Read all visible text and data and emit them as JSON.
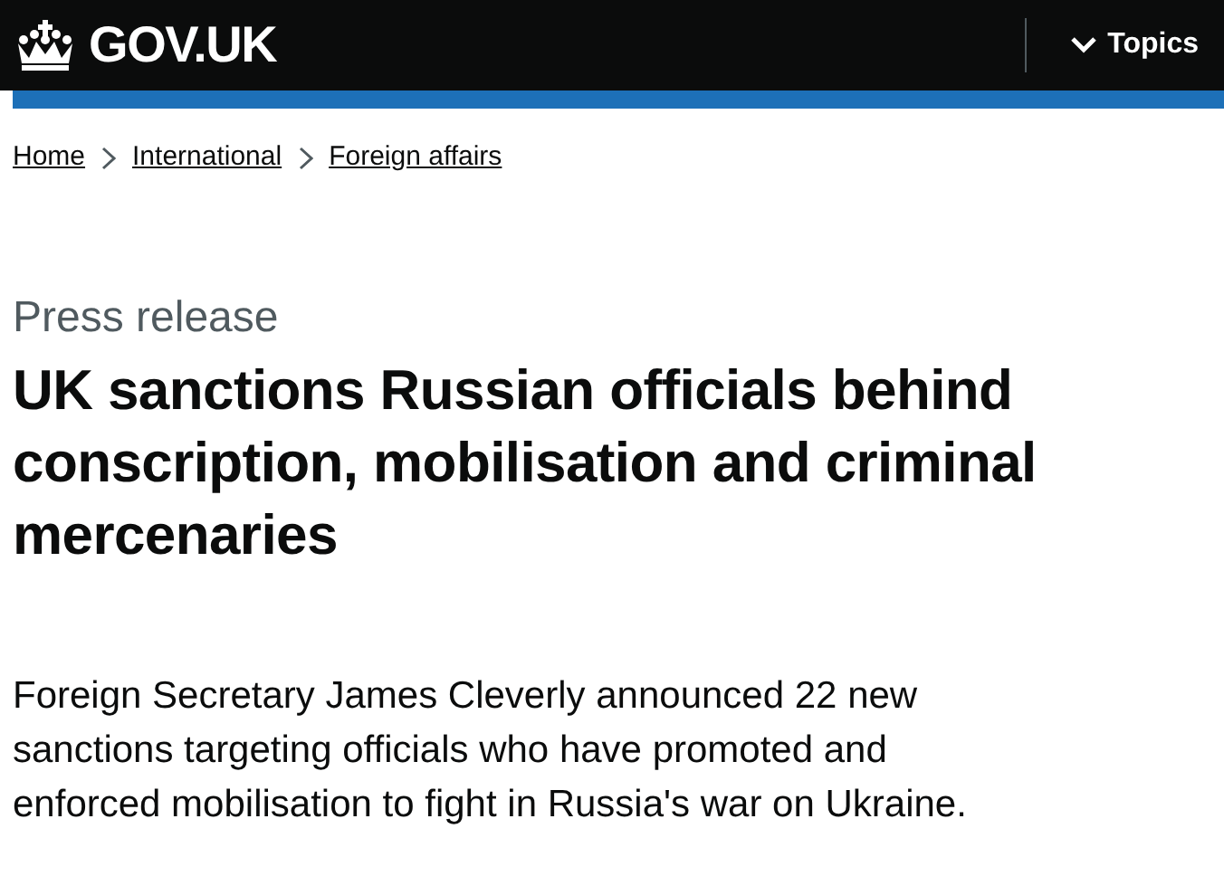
{
  "header": {
    "logo": "GOV.UK",
    "menu_button": "Topics"
  },
  "breadcrumbs": [
    {
      "label": "Home"
    },
    {
      "label": "International"
    },
    {
      "label": "Foreign affairs"
    }
  ],
  "article": {
    "type": "Press release",
    "title": "UK sanctions Russian officials behind conscription, mobilisation and criminal mercenaries",
    "summary": "Foreign Secretary James Cleverly announced 22 new sanctions targeting officials who have promoted and enforced mobilisation to fight in Russia's war on Ukraine."
  }
}
